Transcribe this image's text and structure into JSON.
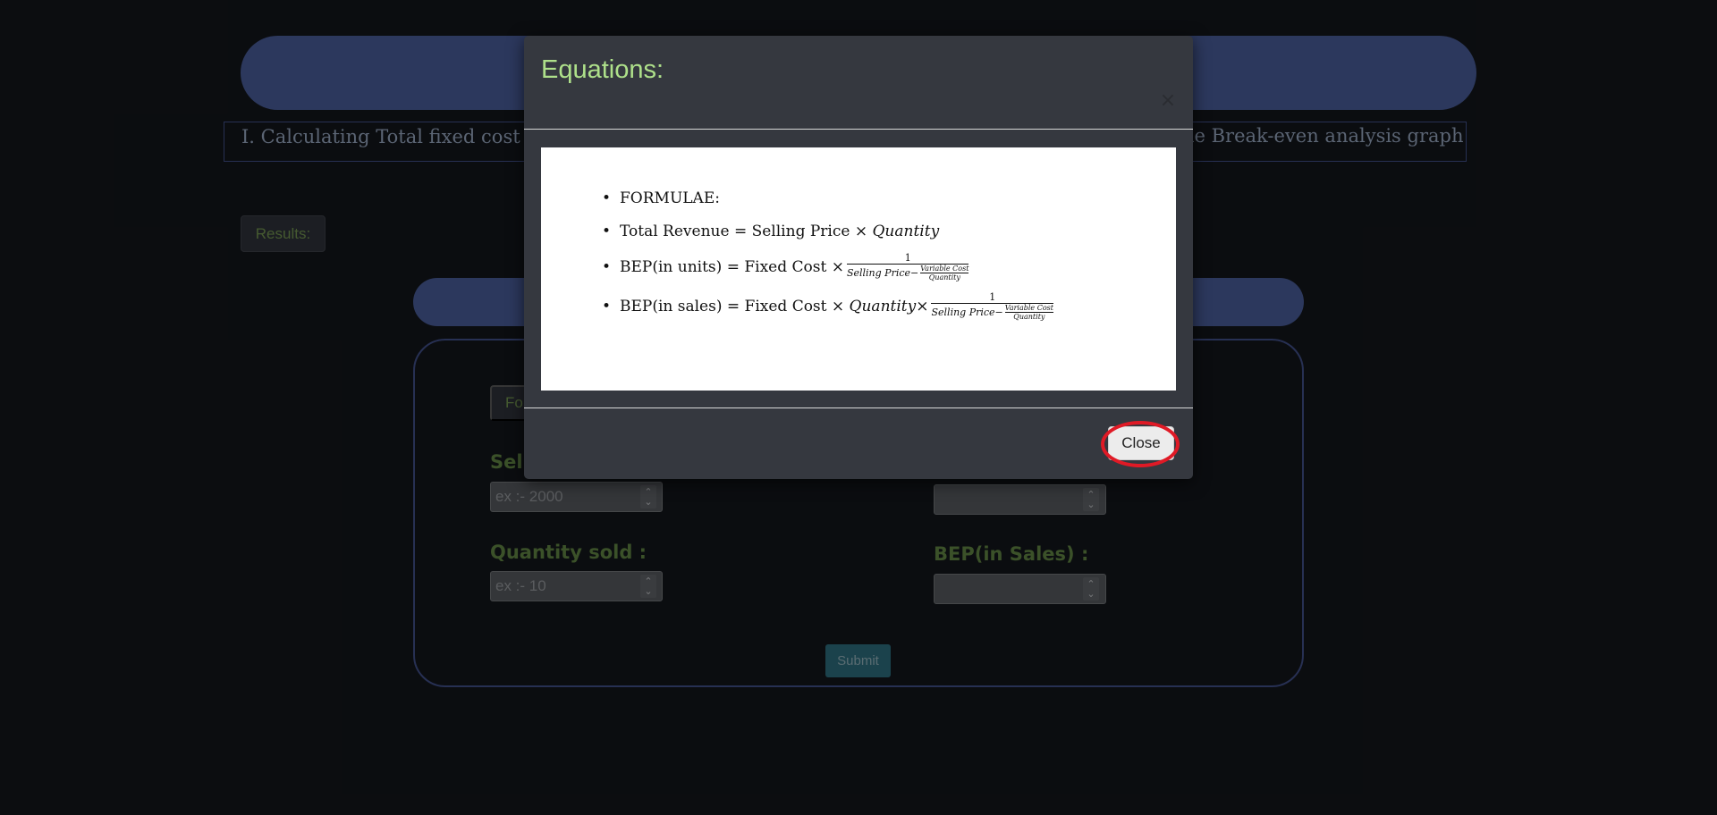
{
  "task": {
    "text_start": "I. Calculating Total fixed cost and",
    "text_end": "he Break-even analysis graph"
  },
  "results_button": "Results:",
  "form": {
    "formula_button": "Formulae",
    "selling_label": "Selling Price :",
    "selling_placeholder": "ex :- 2000",
    "quantity_label": "Quantity sold :",
    "quantity_placeholder": "ex :- 10",
    "bep_sales_label": "BEP(in Sales) :",
    "submit": "Submit"
  },
  "modal": {
    "title": "Equations:",
    "close_x": "×",
    "close_button": "Close",
    "equations": {
      "heading": "FORMULAE:",
      "revenue_prefix": "Total Revenue = Selling  Price ×",
      "revenue_qty": "Quantity",
      "bep_units_prefix": "BEP(in  units) = Fixed Cost ×",
      "bep_sales_prefix": "BEP(in  sales) = Fixed Cost ×",
      "bep_sales_qty": "Quantity",
      "times": "×",
      "frac_one": "1",
      "selling_price": "Selling  Price−",
      "variable_cost": "Variable Cost",
      "quantity": "Quantity"
    }
  },
  "colors": {
    "background": "#121419",
    "banner": "#44568f",
    "label_green": "#5b7d3f",
    "modal_title": "#aee08a",
    "highlight": "#e01a26"
  }
}
